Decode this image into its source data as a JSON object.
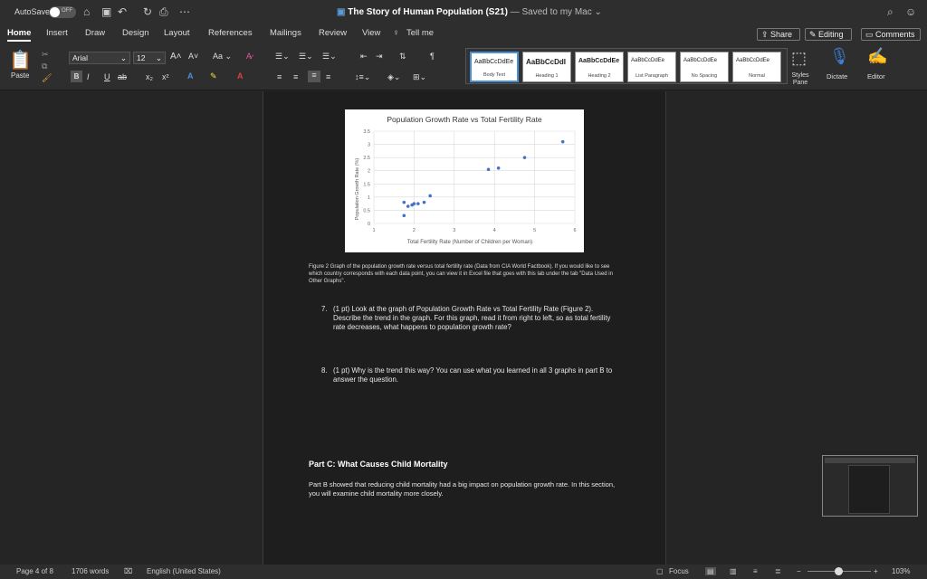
{
  "titlebar": {
    "autosave_label": "AutoSave",
    "autosave_state": "OFF",
    "doc_title": "The Story of Human Population (S21)",
    "saved_status": " — Saved to my Mac ⌄"
  },
  "tabs": [
    {
      "label": "Home",
      "active": true
    },
    {
      "label": "Insert"
    },
    {
      "label": "Draw"
    },
    {
      "label": "Design"
    },
    {
      "label": "Layout"
    },
    {
      "label": "References"
    },
    {
      "label": "Mailings"
    },
    {
      "label": "Review"
    },
    {
      "label": "View"
    },
    {
      "label": "Tell me"
    }
  ],
  "header_buttons": {
    "share": "Share",
    "editing": "Editing",
    "comments": "Comments"
  },
  "ribbon": {
    "paste_label": "Paste",
    "font_name": "Arial",
    "font_size": "12",
    "styles_pane_label": "Styles Pane",
    "dictate_label": "Dictate",
    "editor_label": "Editor",
    "styles": [
      {
        "sample": "AaBbCcDdEe",
        "name": "Body Text"
      },
      {
        "sample": "AaBbCcDdI",
        "name": "Heading 1"
      },
      {
        "sample": "AaBbCcDdEe",
        "name": "Heading 2"
      },
      {
        "sample": "AaBbCcDdEe",
        "name": "List Paragraph"
      },
      {
        "sample": "AaBbCcDdEe",
        "name": "No Spacing"
      },
      {
        "sample": "AaBbCcDdEe",
        "name": "Normal"
      }
    ]
  },
  "chart_data": {
    "type": "scatter",
    "title": "Population Growth Rate vs Total Fertility Rate",
    "xlabel": "Total Fertility Rate (Number of Children per Woman)",
    "ylabel": "Population Growth Rate (%)",
    "xlim": [
      1,
      6
    ],
    "ylim": [
      0,
      3.5
    ],
    "x_ticks": [
      "1",
      "2",
      "3",
      "4",
      "5",
      "6"
    ],
    "y_ticks": [
      "0",
      "0.5",
      "1",
      "1.5",
      "2",
      "2.5",
      "3",
      "3.5"
    ],
    "point_color": "#4472c4",
    "points": [
      {
        "x": 1.75,
        "y": 0.8
      },
      {
        "x": 1.85,
        "y": 0.65
      },
      {
        "x": 1.95,
        "y": 0.7
      },
      {
        "x": 2.0,
        "y": 0.75
      },
      {
        "x": 2.1,
        "y": 0.75
      },
      {
        "x": 2.25,
        "y": 0.8
      },
      {
        "x": 2.4,
        "y": 1.05
      },
      {
        "x": 1.75,
        "y": 0.3
      },
      {
        "x": 3.85,
        "y": 2.05
      },
      {
        "x": 4.1,
        "y": 2.1
      },
      {
        "x": 4.75,
        "y": 2.5
      },
      {
        "x": 5.7,
        "y": 3.1
      }
    ]
  },
  "document": {
    "figure_caption": "Figure 2 Graph of the population growth rate versus total fertility rate (Data from CIA World Factbook). If you would like to see which country corresponds with each data point, you can view it in Excel file that goes with this lab under the tab \"Data Used in Other Graphs\".",
    "q7_num": "7.",
    "q7_text": "(1 pt) Look at the graph of Population Growth Rate vs Total Fertility Rate (Figure 2). Describe the trend in the graph. For this graph, read it from right to left, so as total fertility rate decreases, what happens to population growth rate?",
    "q8_num": "8.",
    "q8_text": "(1 pt) Why is the trend this way? You can use what you learned in all 3 graphs in part B to answer the question.",
    "part_c_heading": "Part C: What Causes Child Mortality",
    "part_c_body": "Part B showed that reducing child mortality had a big impact on population growth rate. In this section, you will examine child mortality more closely."
  },
  "statusbar": {
    "page": "Page 4 of 8",
    "words": "1706 words",
    "language": "English (United States)",
    "focus": "Focus",
    "zoom": "103%"
  }
}
